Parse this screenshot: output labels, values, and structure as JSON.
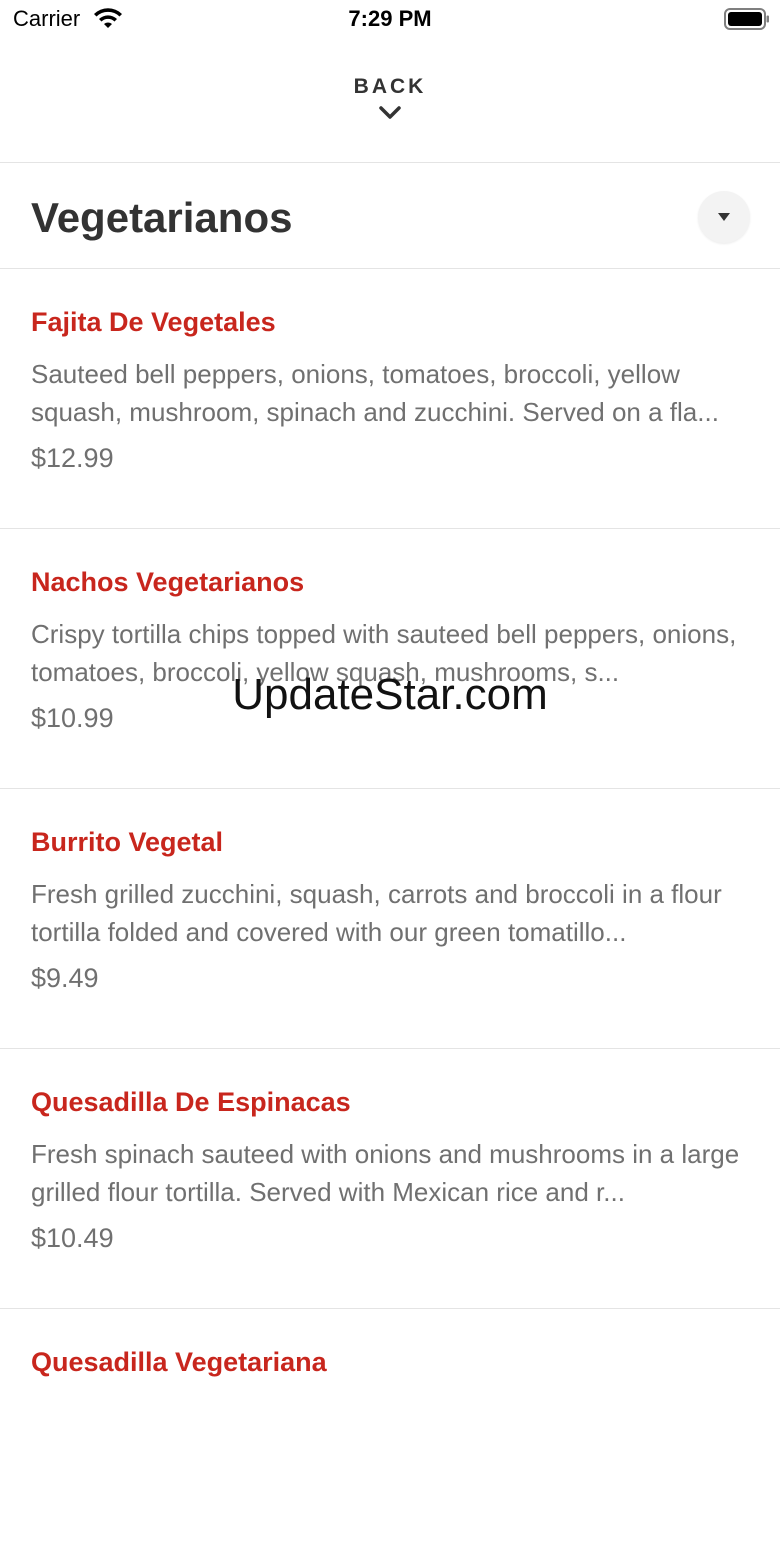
{
  "status_bar": {
    "carrier": "Carrier",
    "time": "7:29 PM",
    "icons": [
      "wifi-icon",
      "battery-icon"
    ]
  },
  "nav": {
    "back_label": "BACK",
    "back_icon": "chevron-down-icon"
  },
  "section": {
    "title": "Vegetarianos",
    "dropdown_icon": "caret-down-icon"
  },
  "menu_items": [
    {
      "name": "Fajita De Vegetales",
      "description": "Sauteed bell peppers, onions, tomatoes, broccoli, yellow squash, mushroom, spinach and zucchini. Served on a fla...",
      "price": "$12.99"
    },
    {
      "name": "Nachos Vegetarianos",
      "description": "Crispy tortilla chips topped with sauteed bell peppers, onions, tomatoes, broccoli, yellow squash, mushrooms, s...",
      "price": "$10.99"
    },
    {
      "name": "Burrito Vegetal",
      "description": "Fresh grilled zucchini, squash, carrots and broccoli in a flour tortilla folded and covered with our green tomatillo...",
      "price": "$9.49"
    },
    {
      "name": "Quesadilla De Espinacas",
      "description": "Fresh spinach sauteed with onions and mushrooms in a large grilled flour tortilla. Served with Mexican rice and r...",
      "price": "$10.49"
    },
    {
      "name": "Quesadilla Vegetariana",
      "description": "",
      "price": ""
    }
  ],
  "watermark": "UpdateStar.com",
  "colors": {
    "accent": "#c8261d",
    "text_primary": "#333333",
    "text_secondary": "#707070",
    "divider": "#e4e4e4"
  }
}
